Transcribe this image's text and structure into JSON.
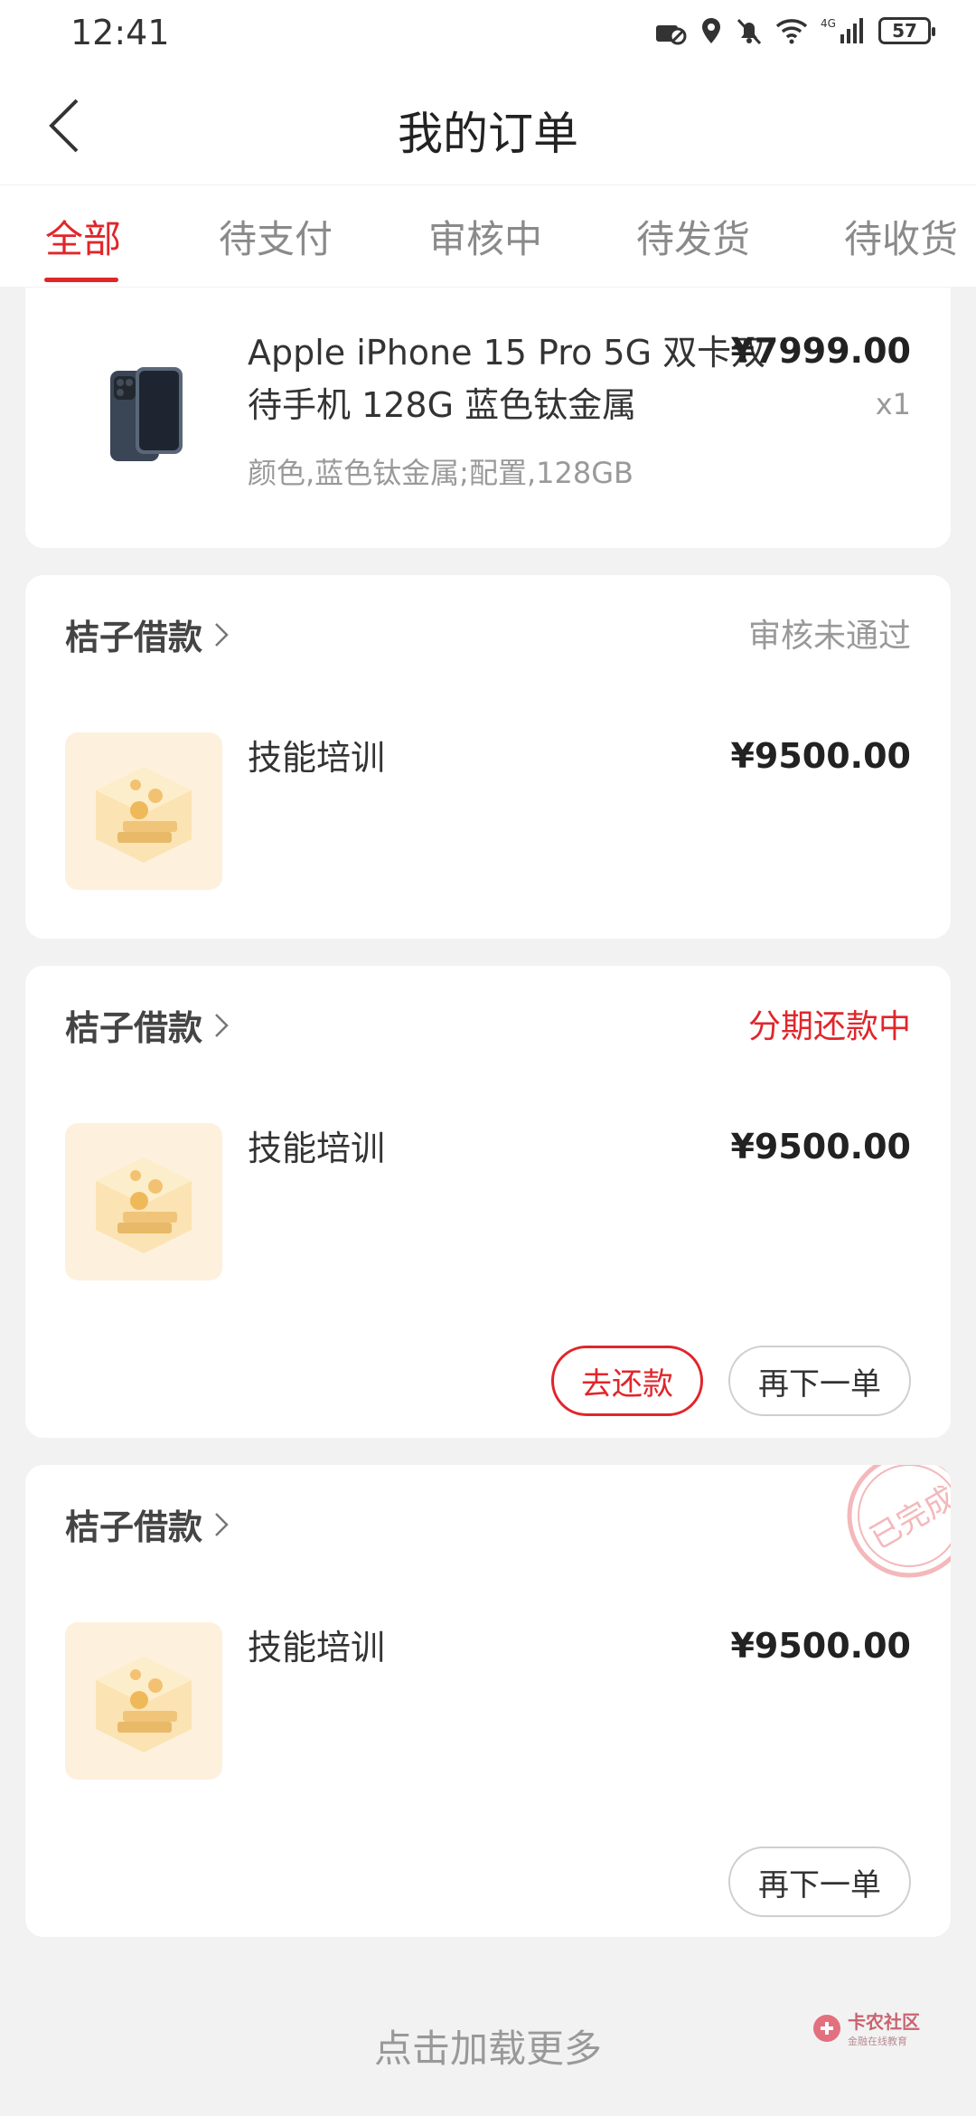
{
  "status_bar": {
    "time": "12:41",
    "battery": "57"
  },
  "header": {
    "title": "我的订单"
  },
  "tabs": [
    {
      "label": "全部"
    },
    {
      "label": "待支付"
    },
    {
      "label": "审核中"
    },
    {
      "label": "待发货"
    },
    {
      "label": "待收货"
    }
  ],
  "top_order": {
    "product_line1": "Apple iPhone 15 Pro 5G 双卡双",
    "product_line2": "待手机 128G 蓝色钛金属",
    "price": "¥7999.00",
    "qty": "x1",
    "spec": "颜色,蓝色钛金属;配置,128GB"
  },
  "orders": [
    {
      "merchant": "桔子借款",
      "status": "审核未通过",
      "item": "技能培训",
      "price": "¥9500.00"
    },
    {
      "merchant": "桔子借款",
      "status": "分期还款中",
      "item": "技能培训",
      "price": "¥9500.00",
      "btn_repay": "去还款",
      "btn_reorder": "再下一单"
    },
    {
      "merchant": "桔子借款",
      "status": "",
      "stamp": "已完成",
      "item": "技能培训",
      "price": "¥9500.00",
      "btn_reorder": "再下一单"
    }
  ],
  "footer": {
    "load_more": "点击加载更多",
    "watermark": "卡农社区",
    "watermark_sub": "金融在线教育"
  },
  "colors": {
    "accent": "#e0262b",
    "thumb_bg": "#fdf1dd"
  }
}
